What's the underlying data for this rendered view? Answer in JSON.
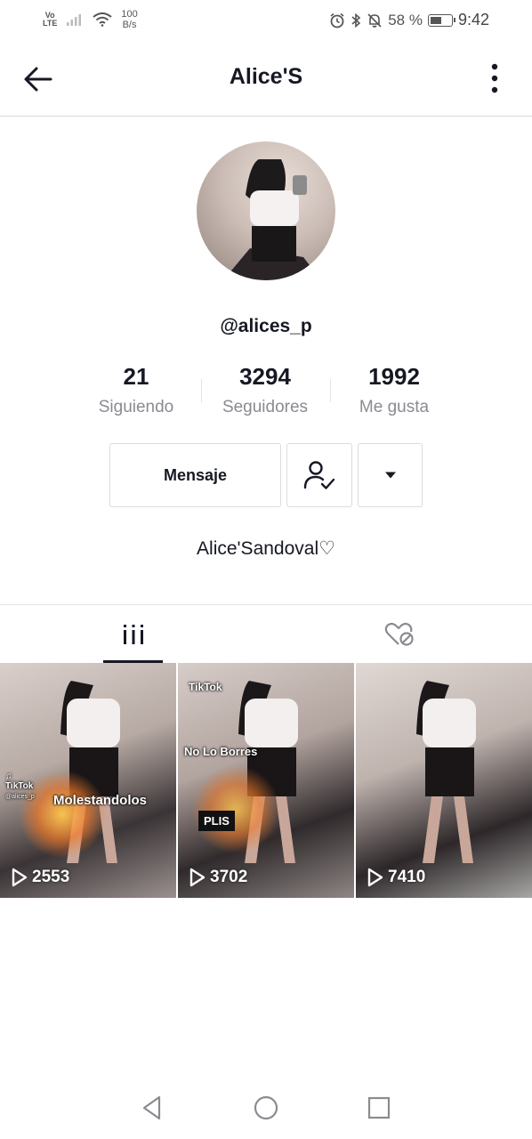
{
  "status_bar": {
    "network": "Vo LTE",
    "speed_value": "100",
    "speed_unit": "B/s",
    "battery_percent": "58 %",
    "battery_level": 0.58,
    "time": "9:42"
  },
  "header": {
    "title": "Alice'S"
  },
  "profile": {
    "handle": "@alices_p",
    "stats": [
      {
        "value": "21",
        "label": "Siguiendo"
      },
      {
        "value": "3294",
        "label": "Seguidores"
      },
      {
        "value": "1992",
        "label": "Me gusta"
      }
    ],
    "message_button": "Mensaje",
    "bio": "Alice'Sandoval♡"
  },
  "videos": [
    {
      "plays": "2553",
      "captions": {
        "watermark": "TikTok",
        "watermark_user": "@alices_p",
        "text": "Molestandolos"
      }
    },
    {
      "plays": "3702",
      "captions": {
        "watermark": "TikTok",
        "text": "No Lo Borres",
        "badge": "PLIS"
      }
    },
    {
      "plays": "7410",
      "captions": {}
    }
  ],
  "icons": {
    "back": "arrow-left-icon",
    "more": "more-vertical-icon",
    "following": "user-check-icon",
    "dropdown": "caret-down-icon",
    "videos_tab": "grid-icon",
    "liked_tab": "heart-hidden-icon",
    "play": "play-icon"
  }
}
